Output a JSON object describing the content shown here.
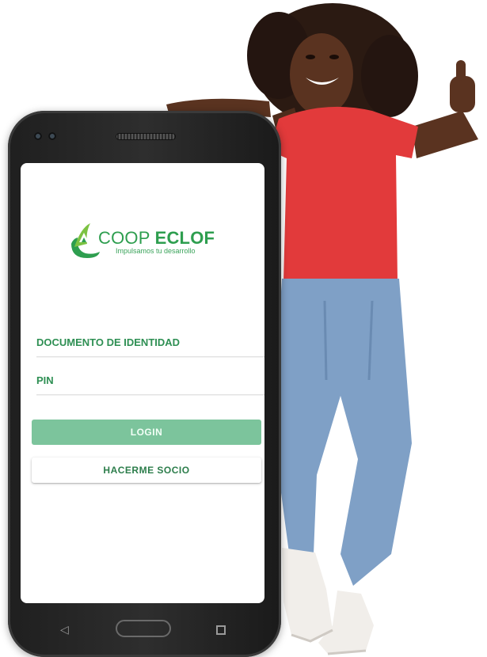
{
  "brand": {
    "name_part1": "COOP",
    "name_part2": "ECLOF",
    "tagline": "Impulsamos tu desarrollo"
  },
  "form": {
    "document_placeholder": "DOCUMENTO DE IDENTIDAD",
    "pin_placeholder": "PIN",
    "login_label": "LOGIN",
    "join_label": "HACERME SOCIO"
  },
  "nav_icons": {
    "back": "back-triangle-icon",
    "home": "home-pill-icon",
    "recent": "recent-square-icon"
  },
  "colors": {
    "brand_green": "#2e9e4f",
    "login_button": "#7cc49c",
    "join_text": "#2c7d4b",
    "phone_body": "#1f1f1f"
  }
}
